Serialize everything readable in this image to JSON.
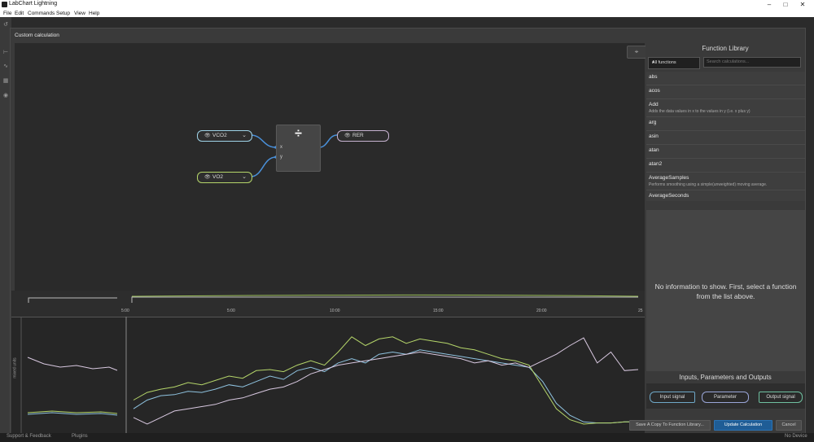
{
  "app": {
    "title": "LabChart Lightning",
    "window_controls": [
      "–",
      "□",
      "✕"
    ]
  },
  "menu": [
    "File",
    "Edit",
    "Commands",
    "Setup",
    "View",
    "Help"
  ],
  "dialog": {
    "title": "Custom calculation",
    "fit_icon": "⌖"
  },
  "graph": {
    "inputs": [
      {
        "label": "VCO2",
        "color": "#9fd3e8"
      },
      {
        "label": "VO2",
        "color": "#b5d66a"
      }
    ],
    "operator": {
      "symbol": "÷",
      "param_x": "x",
      "param_y": "y"
    },
    "output": {
      "label": "RER",
      "color": "#c7b3d1"
    },
    "eye_icon": "👁",
    "chevron_icon": "⌄"
  },
  "chart": {
    "ylabel": "mixed units",
    "ticks": [
      "5:00",
      "5:00",
      "10:00",
      "15:00",
      "20:00",
      "25"
    ]
  },
  "chart_data": {
    "type": "line",
    "title": "",
    "xlabel": "",
    "ylabel": "mixed units",
    "x_ticks": [
      "5:00",
      "10:00",
      "15:00",
      "20:00",
      "25"
    ],
    "series": [
      {
        "name": "VCO2",
        "color": "#8fc3e0",
        "values": [
          0.2,
          0.28,
          0.32,
          0.33,
          0.36,
          0.35,
          0.38,
          0.42,
          0.4,
          0.45,
          0.5,
          0.47,
          0.55,
          0.58,
          0.54,
          0.62,
          0.66,
          0.62,
          0.7,
          0.72,
          0.7,
          0.74,
          0.72,
          0.7,
          0.68,
          0.66,
          0.64,
          0.62,
          0.6,
          0.58,
          0.45,
          0.25,
          0.14,
          0.08,
          0.07,
          0.07,
          0.08,
          0.08
        ]
      },
      {
        "name": "VO2",
        "color": "#b5d66a",
        "values": [
          0.28,
          0.35,
          0.38,
          0.4,
          0.44,
          0.42,
          0.46,
          0.5,
          0.48,
          0.55,
          0.56,
          0.54,
          0.6,
          0.64,
          0.6,
          0.72,
          0.86,
          0.78,
          0.84,
          0.86,
          0.8,
          0.84,
          0.82,
          0.8,
          0.76,
          0.74,
          0.7,
          0.66,
          0.64,
          0.6,
          0.4,
          0.2,
          0.1,
          0.06,
          0.07,
          0.07,
          0.08,
          0.08
        ]
      },
      {
        "name": "RER",
        "color": "#d8c8e0",
        "values": [
          0.12,
          0.06,
          0.12,
          0.18,
          0.2,
          0.22,
          0.24,
          0.28,
          0.3,
          0.34,
          0.38,
          0.4,
          0.45,
          0.52,
          0.56,
          0.6,
          0.62,
          0.64,
          0.66,
          0.68,
          0.7,
          0.72,
          0.7,
          0.68,
          0.66,
          0.62,
          0.64,
          0.6,
          0.62,
          0.58,
          0.64,
          0.7,
          0.78,
          0.85,
          0.62,
          0.72,
          0.55,
          0.56
        ]
      }
    ]
  },
  "library": {
    "title": "Function Library",
    "filter": "All functions",
    "search_placeholder": "Search calculations...",
    "functions": [
      {
        "name": "abs",
        "desc": ""
      },
      {
        "name": "acos",
        "desc": ""
      },
      {
        "name": "Add",
        "desc": "Adds the data values in x to the values in y (i.e. x plus y)"
      },
      {
        "name": "arg",
        "desc": ""
      },
      {
        "name": "asin",
        "desc": ""
      },
      {
        "name": "atan",
        "desc": ""
      },
      {
        "name": "atan2",
        "desc": ""
      },
      {
        "name": "AverageSamples",
        "desc": "Performs smoothing using a simple(unweighted) moving average."
      },
      {
        "name": "AverageSeconds",
        "desc": ""
      }
    ],
    "info_message": "No information to show. First, select a function from the list above."
  },
  "iop": {
    "title": "Inputs, Parameters and Outputs",
    "input": "Input signal",
    "parameter": "Parameter",
    "output": "Output signal"
  },
  "footer": {
    "save_copy": "Save A Copy To Function Library...",
    "update": "Update Calculation",
    "cancel": "Cancel"
  },
  "status": {
    "support": "Support & Feedback",
    "plugins": "Plugins",
    "device": "No Device"
  }
}
